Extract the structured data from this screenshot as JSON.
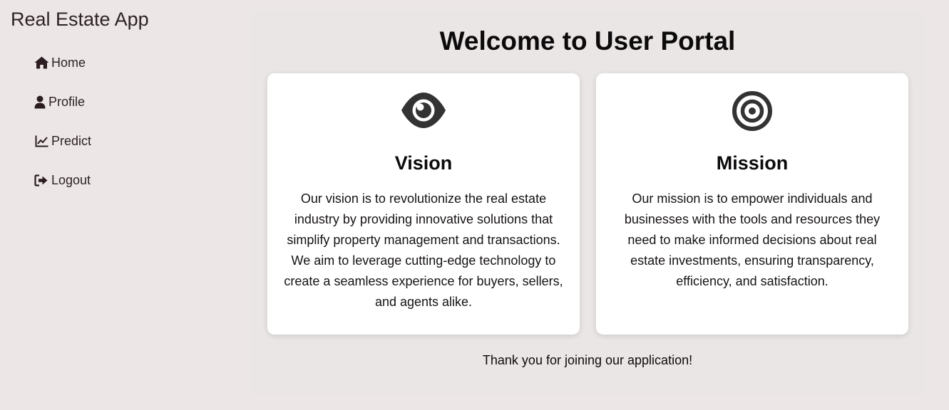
{
  "app": {
    "brand": "Real Estate App"
  },
  "sidebar": {
    "items": [
      {
        "label": "Home",
        "icon": "home-icon"
      },
      {
        "label": "Profile",
        "icon": "user-icon"
      },
      {
        "label": "Predict",
        "icon": "chart-line-icon"
      },
      {
        "label": "Logout",
        "icon": "sign-out-icon"
      }
    ]
  },
  "main": {
    "title": "Welcome to User Portal",
    "cards": [
      {
        "icon": "eye-icon",
        "title": "Vision",
        "text": "Our vision is to revolutionize the real estate industry by providing innovative solutions that simplify property management and transactions. We aim to leverage cutting-edge technology to create a seamless experience for buyers, sellers, and agents alike."
      },
      {
        "icon": "bullseye-icon",
        "title": "Mission",
        "text": "Our mission is to empower individuals and businesses with the tools and resources they need to make informed decisions about real estate investments, ensuring transparency, efficiency, and satisfaction."
      }
    ],
    "footer": "Thank you for joining our application!"
  },
  "colors": {
    "background": "#ece7e6",
    "card": "#ffffff",
    "icon": "#333333",
    "text": "#2d2226"
  }
}
